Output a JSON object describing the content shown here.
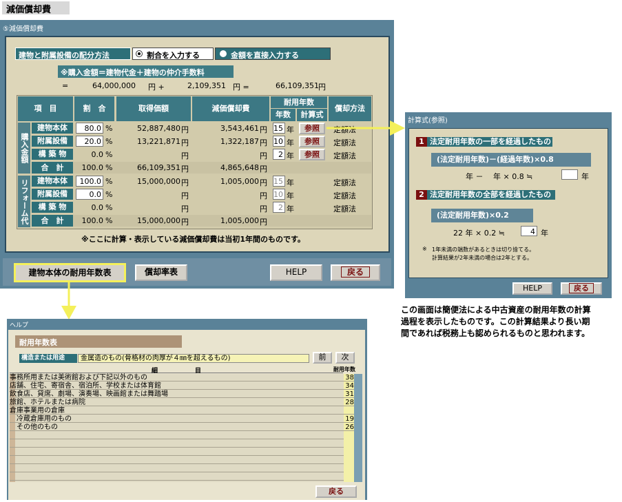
{
  "page_tag": "減価償却費",
  "main": {
    "title": "⑤減価償却費",
    "alloc_label": "建物と附属設備の配分方法",
    "radio_ratio": "割合を入力する",
    "radio_amount": "金額を直接入力する",
    "formula_banner": "※購入金額＝建物代金＋建物の仲介手数料",
    "eq": {
      "sym1": "=",
      "v1": "64,000,000",
      "u1": "円 +",
      "v2": "2,109,351",
      "u2": "円 =",
      "v3": "66,109,351",
      "u3": "円"
    },
    "headers": {
      "item": "項　目",
      "ratio": "割　合",
      "acq": "取得価額",
      "dep": "減価償却費",
      "life": "耐用年数",
      "years": "年数",
      "calc": "計算式",
      "method": "償却方法"
    },
    "group_purchase": "購入金額",
    "group_reform": "リフォーム代",
    "purchase_rows": [
      {
        "label": "建物本体",
        "ratio": "80.0",
        "pct": "%",
        "acq": "52,887,480",
        "yen": "円",
        "dep": "3,543,461",
        "dyen": "円",
        "years": "15",
        "yu": "年",
        "ref": "参照",
        "method": "定額法"
      },
      {
        "label": "附属設備",
        "ratio": "20.0",
        "pct": "%",
        "acq": "13,221,871",
        "yen": "円",
        "dep": "1,322,187",
        "dyen": "円",
        "years": "10",
        "yu": "年",
        "ref": "参照",
        "method": "定額法"
      },
      {
        "label": "構 築 物",
        "ratio": "0.0",
        "pct": "%",
        "acq": "",
        "yen": "円",
        "dep": "",
        "dyen": "円",
        "years": "2",
        "yu": "年",
        "ref": "参照",
        "method": "定額法"
      }
    ],
    "purchase_total": {
      "label": "合　計",
      "ratio": "100.0",
      "pct": "%",
      "acq": "66,109,351",
      "yen": "円",
      "dep": "4,865,648",
      "dyen": "円"
    },
    "reform_rows": [
      {
        "label": "建物本体",
        "ratio": "100.0",
        "pct": "%",
        "acq": "15,000,000",
        "yen": "円",
        "dep": "1,005,000",
        "dyen": "円",
        "years": "15",
        "yu": "年",
        "method": "定額法"
      },
      {
        "label": "附属設備",
        "ratio": "0.0",
        "pct": "%",
        "acq": "",
        "yen": "円",
        "dep": "",
        "dyen": "円",
        "years": "10",
        "yu": "年",
        "method": "定額法"
      },
      {
        "label": "構 築 物",
        "ratio": "0.0",
        "pct": "%",
        "acq": "",
        "yen": "円",
        "dep": "",
        "dyen": "円",
        "years": "2",
        "yu": "年",
        "method": "定額法"
      }
    ],
    "reform_total": {
      "label": "合　計",
      "ratio": "100.0",
      "pct": "%",
      "acq": "15,000,000",
      "yen": "円",
      "dep": "1,005,000",
      "dyen": "円"
    },
    "footnote": "※ここに計算・表示している減価償却費は当初1年間のものです。",
    "btn_life_table": "建物本体の耐用年数表",
    "btn_rate_table": "償却率表",
    "btn_help": "HELP",
    "btn_back": "戻る"
  },
  "calc": {
    "title": "計算式(参照)",
    "s1_num": "1",
    "s1_title": "法定耐用年数の一部を経過したもの",
    "s1_formula": "(法定耐用年数)－(経過年数)×0.8",
    "s1_line": "年 －　 年 × 0.8 ≒",
    "s1_unit": "年",
    "s2_num": "2",
    "s2_title": "法定耐用年数の全部を経過したもの",
    "s2_formula": "(法定耐用年数)×0.2",
    "s2_line": "22 年 × 0.2 ≒",
    "s2_value": "4",
    "s2_unit": "年",
    "note_mark": "※",
    "note1": "1年未満の端数があるときは切り捨てる。",
    "note2": "計算結果が2年未満の場合は2年とする。",
    "btn_help": "HELP",
    "btn_back": "戻る"
  },
  "description": [
    "この画面は簡便法による中古資産の耐用年数の計算",
    "過程を表示したものです。この計算結果より長い期",
    "間であれば税務上も認められるものと思われます。"
  ],
  "help": {
    "title": "ヘルプ",
    "section_title": "耐用年数表",
    "structure_label": "構造または用途",
    "structure_value": "金属造のもの(骨格材の肉厚が４㎜を超えるもの)",
    "btn_prev": "前",
    "btn_next": "次",
    "col_item": "細　　　　　　目",
    "col_life": "耐用年数",
    "rows": [
      {
        "name": "事務所用または美術館および下記以外のもの",
        "years": "38"
      },
      {
        "name": "店舗、住宅、寄宿舎、宿泊所、学校または体育館",
        "years": "34"
      },
      {
        "name": "飲食店、貸席、劇場、演奏場、映画館または舞踏場",
        "years": "31"
      },
      {
        "name": "旅館、ホテルまたは病院",
        "years": "28"
      },
      {
        "name": "倉庫事業用の倉庫",
        "years": ""
      },
      {
        "name": "　冷蔵倉庫用のもの",
        "years": "19"
      },
      {
        "name": "　その他のもの",
        "years": "26"
      }
    ],
    "btn_back": "戻る"
  },
  "colors": {
    "window": "#5a8298",
    "panel": "#ddd6b9",
    "teal": "#2d6f78",
    "arrow": "#f4f05a",
    "brand_red": "#7a1010"
  }
}
